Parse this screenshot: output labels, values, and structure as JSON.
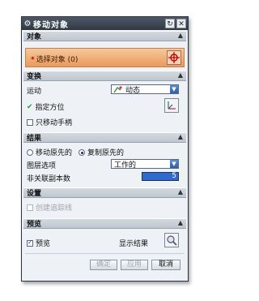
{
  "window": {
    "title": "移动对象",
    "close_label": "✕",
    "reset_label": "↻"
  },
  "sections": {
    "object": {
      "title": "对象",
      "select_label": "选择对象 (0)",
      "star": "*"
    },
    "transform": {
      "title": "变换",
      "motion_label": "运动",
      "motion_value": "动态",
      "specify_orientation": "指定方位"
    },
    "only_move_handle": "只移动手柄",
    "result": {
      "title": "结果",
      "move_original": "移动原先的",
      "copy_original": "复制原先的",
      "layer_option_label": "图层选项",
      "layer_option_value": "工作的",
      "nonassoc_copies_label": "非关联副本数",
      "nonassoc_copies_value": "5"
    },
    "settings": {
      "title": "设置",
      "create_tracking": "创建追踪线"
    },
    "preview": {
      "title": "预览",
      "preview_label": "预览",
      "show_result": "显示结果"
    }
  },
  "buttons": {
    "ok": "确定",
    "apply": "应用",
    "cancel": "取消"
  },
  "colors": {
    "title_bar": "#3a434e",
    "selection_orange": "#ec9f62",
    "dropdown_arrow": "#3d6fbf",
    "number_field": "#2e6ad0"
  }
}
